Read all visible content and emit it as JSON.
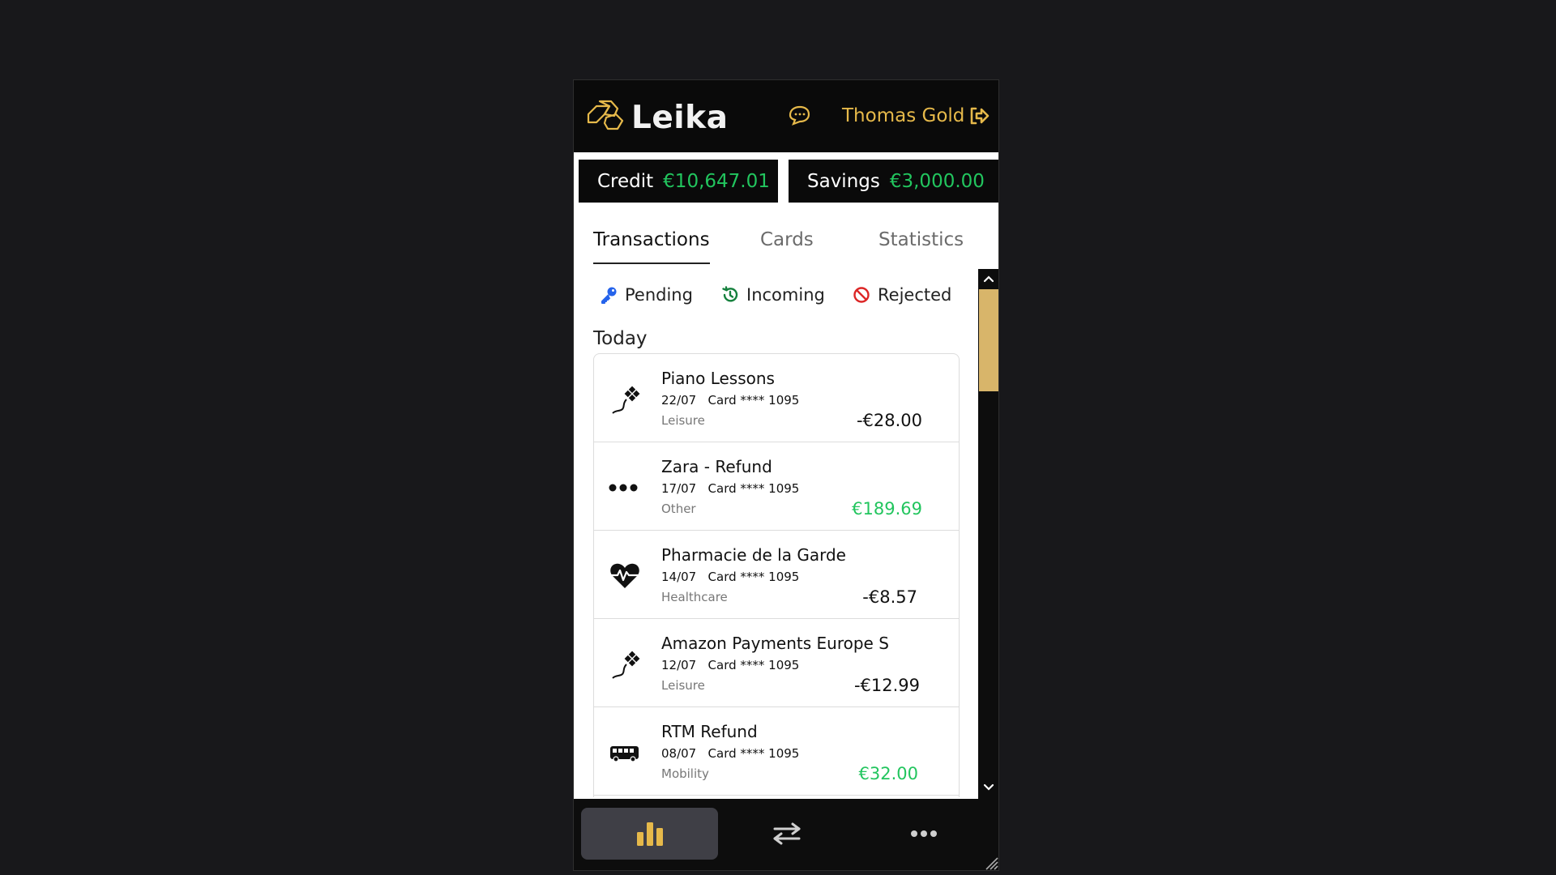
{
  "app": {
    "brand": "Leika",
    "user_name": "Thomas Gold"
  },
  "balances": [
    {
      "label": "Credit",
      "amount": "€10,647.01"
    },
    {
      "label": "Savings",
      "amount": "€3,000.00"
    }
  ],
  "tabs": [
    {
      "label": "Transactions",
      "active": true
    },
    {
      "label": "Cards",
      "active": false
    },
    {
      "label": "Statistics",
      "active": false
    }
  ],
  "filters": [
    {
      "label": "Pending",
      "icon": "key-icon"
    },
    {
      "label": "Incoming",
      "icon": "history-icon"
    },
    {
      "label": "Rejected",
      "icon": "ban-icon"
    }
  ],
  "day_label": "Today",
  "transactions": [
    {
      "name": "Piano Lessons",
      "date": "22/07",
      "card": "Card **** 1095",
      "category": "Leisure",
      "icon": "kite-icon",
      "amount": "-€28.00",
      "positive": false
    },
    {
      "name": "Zara - Refund",
      "date": "17/07",
      "card": "Card **** 1095",
      "category": "Other",
      "icon": "dots-icon",
      "amount": "€189.69",
      "positive": true
    },
    {
      "name": "Pharmacie de la Garde",
      "date": "14/07",
      "card": "Card **** 1095",
      "category": "Healthcare",
      "icon": "heartbeat-icon",
      "amount": "-€8.57",
      "positive": false
    },
    {
      "name": "Amazon Payments Europe S",
      "date": "12/07",
      "card": "Card **** 1095",
      "category": "Leisure",
      "icon": "kite-icon",
      "amount": "-€12.99",
      "positive": false
    },
    {
      "name": "RTM Refund",
      "date": "08/07",
      "card": "Card **** 1095",
      "category": "Mobility",
      "icon": "bus-icon",
      "amount": "€32.00",
      "positive": true
    }
  ],
  "colors": {
    "accent": "#e6b94a",
    "positive": "#22c55e",
    "header_bg": "#0a0a0a"
  },
  "bottom_nav": [
    {
      "icon": "bar-chart-icon",
      "active": true
    },
    {
      "icon": "transfer-icon",
      "active": false
    },
    {
      "icon": "more-icon",
      "active": false
    }
  ]
}
